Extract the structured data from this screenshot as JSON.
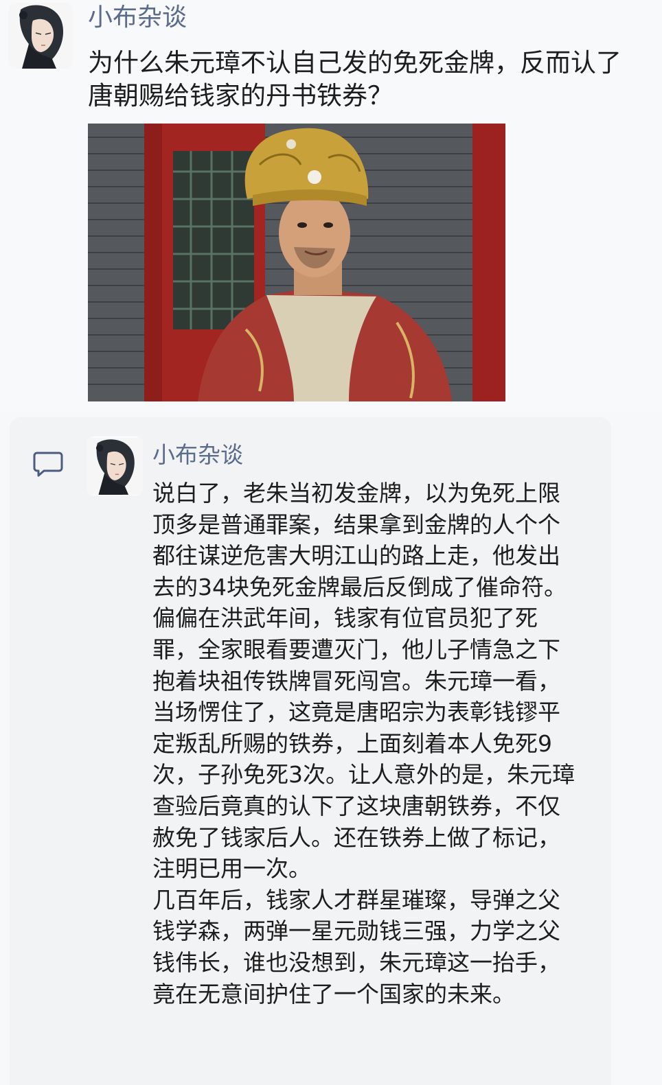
{
  "post": {
    "author": "小布杂谈",
    "title": "为什么朱元璋不认自己发的免死金牌，反而认了唐朝赐给钱家的丹书铁券？",
    "avatar_icon": "user-avatar-icon",
    "image": "costume-drama-still"
  },
  "comment": {
    "icon": "comment-bubble-icon",
    "author": "小布杂谈",
    "paragraphs": [
      "说白了，老朱当初发金牌，以为免死上限顶多是普通罪案，结果拿到金牌的人个个都往谋逆危害大明江山的路上走，他发出去的34块免死金牌最后反倒成了催命符。",
      "偏偏在洪武年间，钱家有位官员犯了死罪，全家眼看要遭灭门，他儿子情急之下抱着块祖传铁牌冒死闯宫。朱元璋一看，当场愣住了，这竟是唐昭宗为表彰钱镠平定叛乱所赐的铁券，上面刻着本人免死9次，子孙免死3次。让人意外的是，朱元璋查验后竟真的认下了这块唐朝铁券，不仅赦免了钱家后人。还在铁券上做了标记，注明已用一次。",
      "几百年后，钱家人才群星璀璨，导弹之父钱学森，两弹一星元勋钱三强，力学之父钱伟长，谁也没想到，朱元璋这一抬手，竟在无意间护住了一个国家的未来。"
    ]
  },
  "colors": {
    "name_color": "#5b6b8c",
    "card_bg": "#f2f3f5",
    "page_bg": "#f7f8fa"
  }
}
